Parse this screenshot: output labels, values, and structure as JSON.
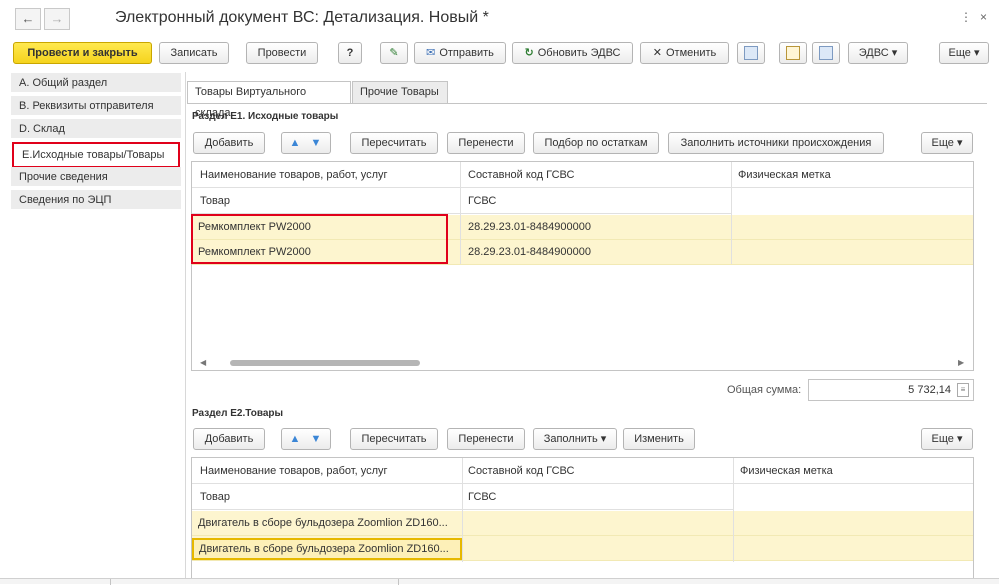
{
  "window": {
    "title": "Электронный документ ВС: Детализация. Новый *",
    "back_icon": "←",
    "forward_icon": "→",
    "menu_icon": "⋮",
    "close_icon": "×"
  },
  "toolbar": {
    "post_close": "Провести и закрыть",
    "save": "Записать",
    "post": "Провести",
    "help": "?",
    "edit_icon": "✎",
    "send": "Отправить",
    "refresh": "Обновить ЭДВС",
    "cancel": "Отменить",
    "edvs": "ЭДВС",
    "more": "Еще"
  },
  "sidebar": {
    "items": [
      {
        "label": "А. Общий раздел"
      },
      {
        "label": "B. Реквизиты отправителя"
      },
      {
        "label": "D. Склад"
      },
      {
        "label": "E.Исходные товары/Товары"
      },
      {
        "label": "Прочие сведения"
      },
      {
        "label": "Сведения по ЭЦП"
      }
    ]
  },
  "tabs": [
    {
      "label": "Товары Виртуального склада"
    },
    {
      "label": "Прочие Товары"
    }
  ],
  "section_e1": {
    "title": "Раздел Е1. Исходные товары",
    "buttons": {
      "add": "Добавить",
      "recalc": "Пересчитать",
      "move": "Перенести",
      "pick": "Подбор по остаткам",
      "fill_sources": "Заполнить источники происхождения",
      "more": "Еще"
    },
    "columns": [
      "Наименование товаров, работ, услуг",
      "Составной код ГСВС",
      "Физическая метка"
    ],
    "subheaders": [
      "Товар",
      "ГСВС"
    ],
    "rows": [
      {
        "name": "Ремкомплект PW2000",
        "code": "28.29.23.01-8484900000"
      },
      {
        "name": "Ремкомплект PW2000",
        "code": "28.29.23.01-8484900000"
      }
    ],
    "total_label": "Общая сумма:",
    "total_value": "5 732,14"
  },
  "section_e2": {
    "title": "Раздел Е2.Товары",
    "buttons": {
      "add": "Добавить",
      "recalc": "Пересчитать",
      "move": "Перенести",
      "fill": "Заполнить",
      "change": "Изменить",
      "more": "Еще"
    },
    "columns": [
      "Наименование товаров, работ, услуг",
      "Составной код ГСВС",
      "Физическая метка"
    ],
    "subheaders": [
      "Товар",
      "ГСВС"
    ],
    "rows": [
      {
        "name": "Двигатель в сборе бульдозера Zoomlion ZD160..."
      },
      {
        "name": "Двигатель в сборе бульдозера Zoomlion ZD160..."
      }
    ]
  }
}
